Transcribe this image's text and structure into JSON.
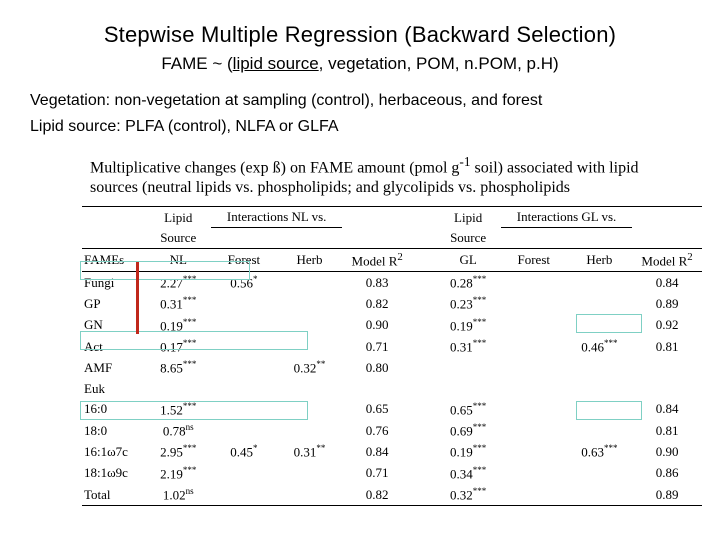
{
  "title": "Stepwise Multiple Regression (Backward Selection)",
  "model_prefix": "FAME ~ (",
  "model_ul": "lipid source",
  "model_rest": ", vegetation, POM, n.POM, p.H)",
  "veg_note": "Vegetation: non-vegetation at sampling (control), herbaceous, and forest",
  "lip_note": "Lipid source: PLFA (control), NLFA or GLFA",
  "caption_a": "Multiplicative changes (exp ß) on FAME amount (pmol g",
  "caption_sup": "-1",
  "caption_b": " soil) associated with lipid sources (neutral lipids vs. phospholipids; and glycolipids vs. phospholipids",
  "h": {
    "fames": "FAMEs",
    "lipid": "Lipid",
    "source": "Source",
    "inter_nl": "Interactions NL vs.",
    "inter_gl": "Interactions GL vs.",
    "nl": "NL",
    "gl": "GL",
    "forest": "Forest",
    "herb": "Herb",
    "r2": "Model R",
    "r2sup": "2"
  },
  "rows": [
    {
      "name": "Fungi",
      "nl": "2.27",
      "nls": "***",
      "nf": "0.56",
      "nfs": "*",
      "nh": "",
      "nhs": "",
      "nr2": "0.83",
      "gl": "0.28",
      "gls": "***",
      "gf": "",
      "gfs": "",
      "gh": "",
      "ghs": "",
      "gr2": "0.84"
    },
    {
      "name": "GP",
      "nl": "0.31",
      "nls": "***",
      "nf": "",
      "nfs": "",
      "nh": "",
      "nhs": "",
      "nr2": "0.82",
      "gl": "0.23",
      "gls": "***",
      "gf": "",
      "gfs": "",
      "gh": "",
      "ghs": "",
      "gr2": "0.89"
    },
    {
      "name": "GN",
      "nl": "0.19",
      "nls": "***",
      "nf": "",
      "nfs": "",
      "nh": "",
      "nhs": "",
      "nr2": "0.90",
      "gl": "0.19",
      "gls": "***",
      "gf": "",
      "gfs": "",
      "gh": "",
      "ghs": "",
      "gr2": "0.92"
    },
    {
      "name": "Act",
      "nl": "0.17",
      "nls": "***",
      "nf": "",
      "nfs": "",
      "nh": "",
      "nhs": "",
      "nr2": "0.71",
      "gl": "0.31",
      "gls": "***",
      "gf": "",
      "gfs": "",
      "gh": "0.46",
      "ghs": "***",
      "gr2": "0.81"
    },
    {
      "name": "AMF",
      "nl": "8.65",
      "nls": "***",
      "nf": "",
      "nfs": "",
      "nh": "0.32",
      "nhs": "**",
      "nr2": "0.80",
      "gl": "",
      "gls": "",
      "gf": "",
      "gfs": "",
      "gh": "",
      "ghs": "",
      "gr2": ""
    },
    {
      "name": "Euk",
      "nl": "",
      "nls": "",
      "nf": "",
      "nfs": "",
      "nh": "",
      "nhs": "",
      "nr2": "",
      "gl": "",
      "gls": "",
      "gf": "",
      "gfs": "",
      "gh": "",
      "ghs": "",
      "gr2": ""
    },
    {
      "name": "16:0",
      "nl": "1.52",
      "nls": "***",
      "nf": "",
      "nfs": "",
      "nh": "",
      "nhs": "",
      "nr2": "0.65",
      "gl": "0.65",
      "gls": "***",
      "gf": "",
      "gfs": "",
      "gh": "",
      "ghs": "",
      "gr2": "0.84"
    },
    {
      "name": "18:0",
      "nl": "0.78",
      "nls": "ns",
      "nf": "",
      "nfs": "",
      "nh": "",
      "nhs": "",
      "nr2": "0.76",
      "gl": "0.69",
      "gls": "***",
      "gf": "",
      "gfs": "",
      "gh": "",
      "ghs": "",
      "gr2": "0.81"
    },
    {
      "name": "16:1ω7c",
      "nl": "2.95",
      "nls": "***",
      "nf": "0.45",
      "nfs": "*",
      "nh": "0.31",
      "nhs": "**",
      "nr2": "0.84",
      "gl": "0.19",
      "gls": "***",
      "gf": "",
      "gfs": "",
      "gh": "0.63",
      "ghs": "***",
      "gr2": "0.90"
    },
    {
      "name": "18:1ω9c",
      "nl": "2.19",
      "nls": "***",
      "nf": "",
      "nfs": "",
      "nh": "",
      "nhs": "",
      "nr2": "0.71",
      "gl": "0.34",
      "gls": "***",
      "gf": "",
      "gfs": "",
      "gh": "",
      "ghs": "",
      "gr2": "0.86"
    },
    {
      "name": "Total",
      "nl": "1.02",
      "nls": "ns",
      "nf": "",
      "nfs": "",
      "nh": "",
      "nhs": "",
      "nr2": "0.82",
      "gl": "0.32",
      "gls": "***",
      "gf": "",
      "gfs": "",
      "gh": "",
      "ghs": "",
      "gr2": "0.89"
    }
  ],
  "chart_data": {
    "type": "table",
    "title": "Multiplicative changes (exp β) on FAME amount by lipid source and vegetation interactions",
    "fames": [
      "Fungi",
      "GP",
      "GN",
      "Act",
      "AMF",
      "Euk",
      "16:0",
      "18:0",
      "16:1ω7c",
      "18:1ω9c",
      "Total"
    ],
    "NL_source": [
      2.27,
      0.31,
      0.19,
      0.17,
      8.65,
      null,
      1.52,
      0.78,
      2.95,
      2.19,
      1.02
    ],
    "NL_source_sig": [
      "***",
      "***",
      "***",
      "***",
      "***",
      null,
      "***",
      "ns",
      "***",
      "***",
      "ns"
    ],
    "NL_forest": [
      0.56,
      null,
      null,
      null,
      null,
      null,
      null,
      null,
      0.45,
      null,
      null
    ],
    "NL_herb": [
      null,
      null,
      null,
      null,
      0.32,
      null,
      null,
      null,
      0.31,
      null,
      null
    ],
    "NL_R2": [
      0.83,
      0.82,
      0.9,
      0.71,
      0.8,
      null,
      0.65,
      0.76,
      0.84,
      0.71,
      0.82
    ],
    "GL_source": [
      0.28,
      0.23,
      0.19,
      0.31,
      null,
      null,
      0.65,
      0.69,
      0.19,
      0.34,
      0.32
    ],
    "GL_source_sig": [
      "***",
      "***",
      "***",
      "***",
      null,
      null,
      "***",
      "***",
      "***",
      "***",
      "***"
    ],
    "GL_forest": [
      null,
      null,
      null,
      null,
      null,
      null,
      null,
      null,
      null,
      null,
      null
    ],
    "GL_herb": [
      null,
      null,
      null,
      0.46,
      null,
      null,
      null,
      null,
      0.63,
      null,
      null
    ],
    "GL_R2": [
      0.84,
      0.89,
      0.92,
      0.81,
      null,
      null,
      0.84,
      0.81,
      0.9,
      0.86,
      0.89
    ]
  }
}
